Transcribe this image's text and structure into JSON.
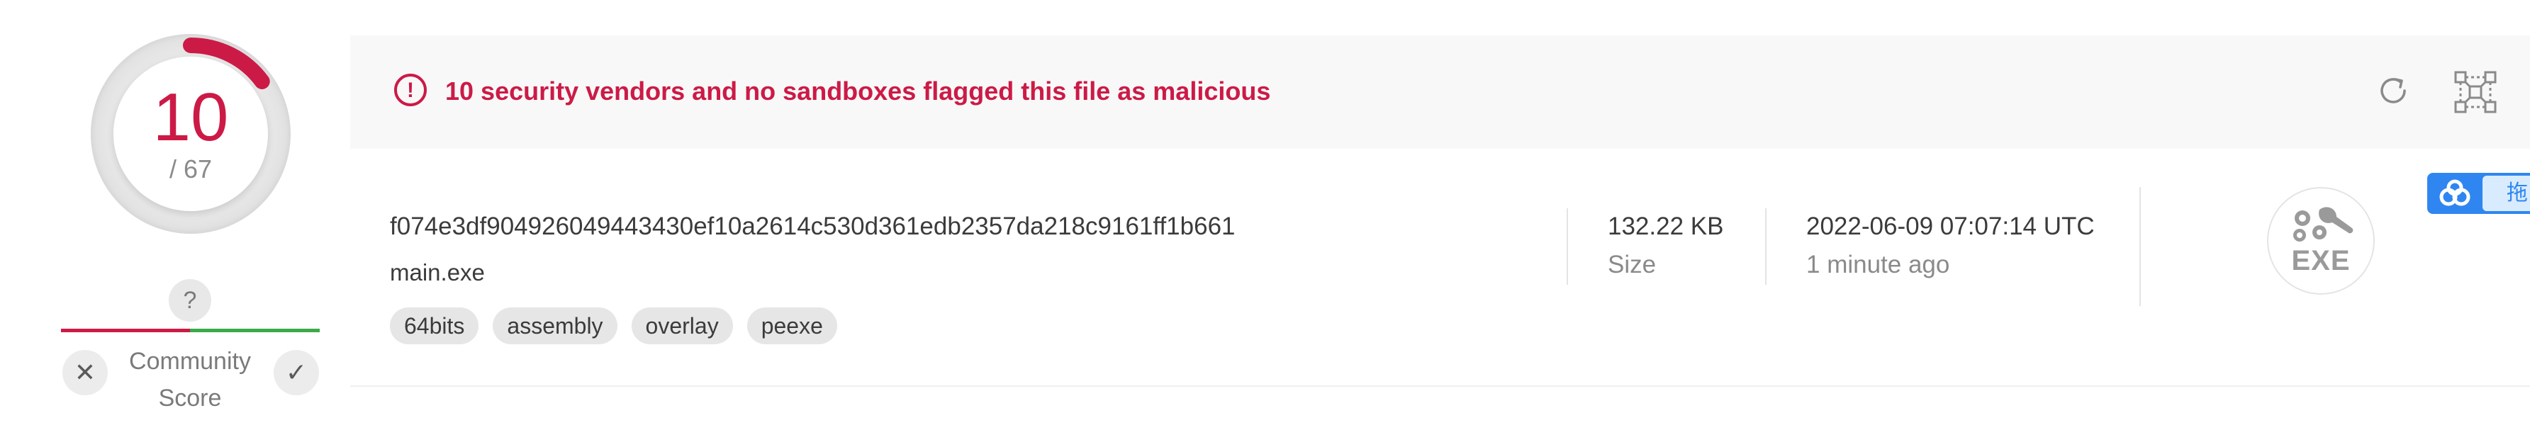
{
  "detection": {
    "score": "10",
    "total": "/ 67",
    "score_fraction": 0.149,
    "alert_message": "10 security vendors and no sandboxes flagged this file as malicious"
  },
  "community_score": {
    "value": "?",
    "label_line1": "Community",
    "label_line2": "Score"
  },
  "file": {
    "hash": "f074e3df904926049443430ef10a2614c530d361edb2357da218c9161ff1b661",
    "name": "main.exe",
    "tags": [
      "64bits",
      "assembly",
      "overlay",
      "peexe"
    ],
    "size_value": "132.22 KB",
    "size_label": "Size",
    "date_value": "2022-06-09 07:07:14 UTC",
    "date_relative": "1 minute ago",
    "type_label": "EXE"
  },
  "side_widget": {
    "label": "拖"
  },
  "colors": {
    "malicious": "#cc1a46",
    "harmless": "#3aaa4a",
    "widget": "#2f86f0"
  },
  "icons": {
    "alert": "exclamation-circle-icon",
    "reanalyze": "refresh-icon",
    "similar": "graph-nodes-icon",
    "vote_down": "close-icon",
    "vote_up": "check-icon",
    "file_type": "exe-gears-icon"
  }
}
